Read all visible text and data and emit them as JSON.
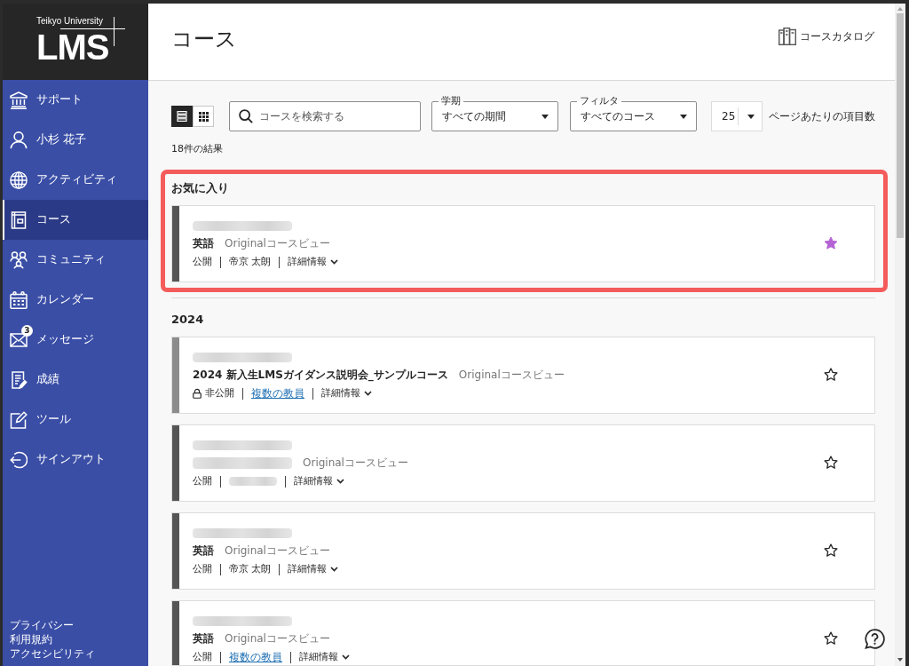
{
  "sidebar": {
    "logo": {
      "subtitle": "Teikyo University",
      "title": "LMS"
    },
    "items": [
      {
        "label": "サポート",
        "selected": false
      },
      {
        "label": "小杉 花子",
        "selected": false
      },
      {
        "label": "アクティビティ",
        "selected": false
      },
      {
        "label": "コース",
        "selected": true
      },
      {
        "label": "コミュニティ",
        "selected": false
      },
      {
        "label": "カレンダー",
        "selected": false
      },
      {
        "label": "メッセージ",
        "selected": false,
        "badge": "3"
      },
      {
        "label": "成績",
        "selected": false
      },
      {
        "label": "ツール",
        "selected": false
      },
      {
        "label": "サインアウト",
        "selected": false
      }
    ],
    "footer_links": [
      "プライバシー",
      "利用規約",
      "アクセシビリティ"
    ]
  },
  "header": {
    "title": "コース",
    "catalog_link": "コースカタログ"
  },
  "toolbar": {
    "view_modes": [
      {
        "kind": "list",
        "selected": true
      },
      {
        "kind": "grid",
        "selected": false
      }
    ],
    "search": {
      "placeholder": "コースを検索する"
    },
    "term": {
      "label": "学期",
      "value": "すべての期間"
    },
    "filter": {
      "label": "フィルタ",
      "value": "すべてのコース"
    },
    "page_size": {
      "value": "25",
      "label": "ページあたりの項目数"
    }
  },
  "results": "18件の結果",
  "sections": [
    {
      "title": "お気に入り",
      "highlighted": true,
      "courses": [
        {
          "code_blurred": true,
          "title_blurred": false,
          "title": "英語",
          "view": "Originalコースビュー",
          "visibility": "公開",
          "private": false,
          "instructor": {
            "kind": "text",
            "name": "帝京 太朗"
          },
          "details": "詳細情報",
          "favorite": true
        }
      ]
    },
    {
      "title": "2024",
      "highlighted": false,
      "courses": [
        {
          "code_blurred": true,
          "title_blurred": false,
          "title": "2024 新入生LMSガイダンス説明会_サンプルコース",
          "view": "Originalコースビュー",
          "visibility": "非公開",
          "private": true,
          "instructor": {
            "kind": "link",
            "name": "複数の教員"
          },
          "details": "詳細情報",
          "favorite": false
        },
        {
          "code_blurred": true,
          "title_blurred": true,
          "view": "Originalコースビュー",
          "visibility": "公開",
          "private": false,
          "instructor": {
            "kind": "blurred"
          },
          "details": "詳細情報",
          "favorite": false
        },
        {
          "code_blurred": true,
          "title_blurred": false,
          "title": "英語",
          "view": "Originalコースビュー",
          "visibility": "公開",
          "private": false,
          "instructor": {
            "kind": "text",
            "name": "帝京 太朗"
          },
          "details": "詳細情報",
          "favorite": false
        },
        {
          "code_blurred": true,
          "title_blurred": false,
          "title": "英語",
          "view": "Originalコースビュー",
          "visibility": "公開",
          "private": false,
          "instructor": {
            "kind": "link",
            "name": "複数の教員"
          },
          "details": "詳細情報",
          "favorite": false
        }
      ]
    }
  ]
}
